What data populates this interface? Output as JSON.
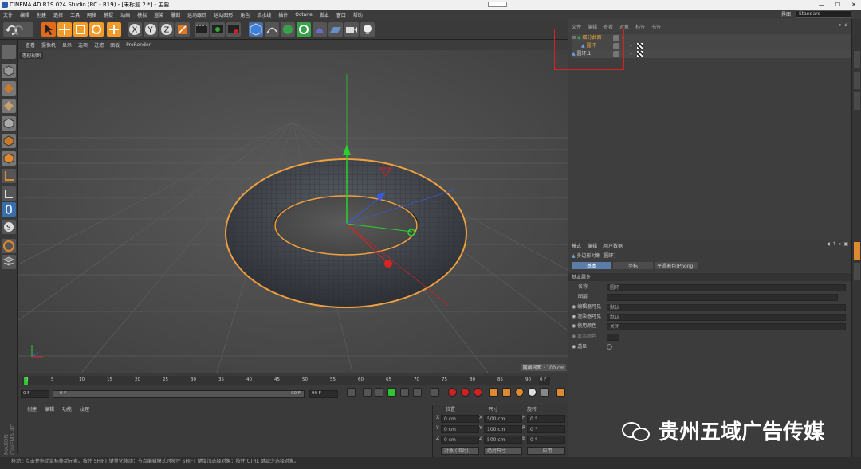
{
  "window": {
    "title": "CINEMA 4D R19.024 Studio (RC - R19) - [未标题 2 *] - 主要"
  },
  "menu": {
    "items": [
      "文件",
      "编辑",
      "创建",
      "选择",
      "工具",
      "网格",
      "捕捉",
      "动画",
      "模拟",
      "渲染",
      "雕刻",
      "运动跟踪",
      "运动图形",
      "角色",
      "流水线",
      "插件",
      "Octane",
      "脚本",
      "窗口",
      "帮助"
    ],
    "layout_label": "界面",
    "layout_value": "Standard"
  },
  "viewport": {
    "menu": [
      "查看",
      "摄像机",
      "显示",
      "选项",
      "过滤",
      "面板",
      "ProRender"
    ],
    "label": "透视视图",
    "grid_info": "网格间距 : 100 cm"
  },
  "timeline": {
    "ticks": [
      "0",
      "5",
      "10",
      "15",
      "20",
      "25",
      "30",
      "35",
      "40",
      "45",
      "50",
      "55",
      "60",
      "65",
      "70",
      "75",
      "80",
      "85",
      "90"
    ],
    "end_frame": "0 F",
    "current_frame": "0 F",
    "range_start": "0 F",
    "range_end": "90 F",
    "max_frame": "90 F"
  },
  "materials": {
    "tabs": [
      "创建",
      "编辑",
      "功能",
      "纹理"
    ]
  },
  "coords": {
    "headers": [
      "位置",
      "尺寸",
      "旋转"
    ],
    "rows": [
      {
        "axis": "X",
        "pos": "0 cm",
        "size_axis": "X",
        "size": "500 cm",
        "rot_axis": "H",
        "rot": "0 °"
      },
      {
        "axis": "Y",
        "pos": "0 cm",
        "size_axis": "Y",
        "size": "100 cm",
        "rot_axis": "P",
        "rot": "0 °"
      },
      {
        "axis": "Z",
        "pos": "0 cm",
        "size_axis": "Z",
        "size": "500 cm",
        "rot_axis": "B",
        "rot": "0 °"
      }
    ],
    "mode1": "对象 (相对)",
    "mode2": "绝对尺寸",
    "apply": "应用"
  },
  "objects": {
    "tabs": [
      "文件",
      "编辑",
      "查看",
      "对象",
      "标签",
      "书签"
    ],
    "rows": [
      {
        "name": "细分曲面",
        "level": 0
      },
      {
        "name": "圆环",
        "level": 1
      },
      {
        "name": "圆环.1",
        "level": 0
      }
    ]
  },
  "attributes": {
    "tabs": [
      "模式",
      "编辑",
      "用户数据"
    ],
    "object_title": "多边形对象 [圆环]",
    "subtabs": [
      "基本",
      "坐标",
      "平滑着色(Phong)"
    ],
    "section": "基本属性",
    "fields": [
      {
        "label": "名称",
        "value": "圆环"
      },
      {
        "label": "图层",
        "value": ""
      },
      {
        "label": "编辑器可见",
        "value": "默认"
      },
      {
        "label": "渲染器可见",
        "value": "默认"
      },
      {
        "label": "使用颜色",
        "value": "关闭"
      },
      {
        "label": "显示颜色",
        "value": ""
      },
      {
        "label": "透显",
        "value": ""
      }
    ]
  },
  "status": {
    "text": "移动 : 点击并拖动鼠标移动元素。按住 SHIFT 键量化移动；节点编辑模式时按住 SHIFT 键增加选择对象；按住 CTRL 键减少选择对象。"
  },
  "watermark": {
    "text": "贵州五域广告传媒"
  },
  "colors": {
    "selection_box": "#e02020",
    "torus_outline": "#f0a030",
    "active_frame": "#2ec82e"
  }
}
